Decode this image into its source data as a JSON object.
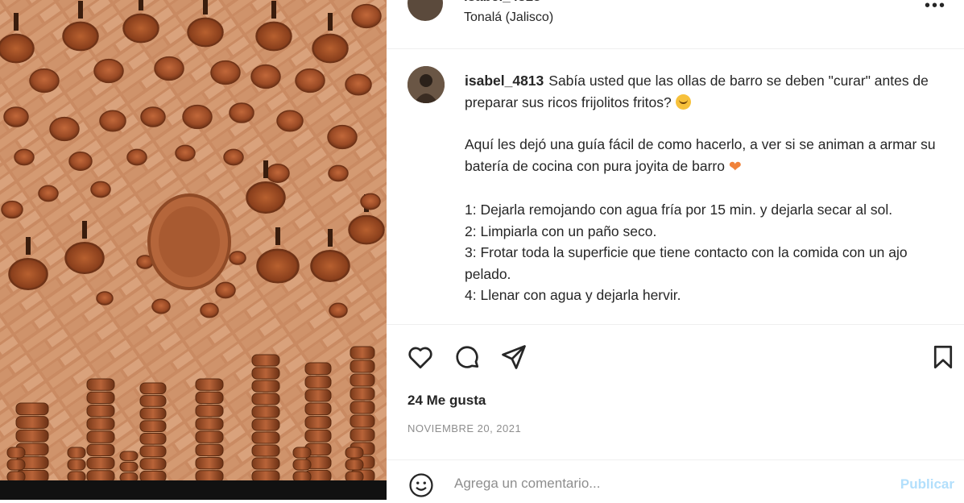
{
  "post": {
    "username": "isabel_4813",
    "location": "Tonalá (Jalisco)",
    "caption": {
      "line1": "Sabía usted que las ollas de barro se deben \"curar\" antes de preparar sus ricos frijolitos fritos?",
      "line2": "Aquí les dejó una guía fácil de como hacerlo, a ver si se animan a armar su batería de cocina con pura joyita de barro",
      "step1": "1: Dejarla remojando con agua fría por 15 min. y dejarla secar al sol.",
      "step2": "2: Limpiarla con un paño seco.",
      "step3": "3: Frotar toda la superficie que tiene contacto con la comida con un ajo pelado.",
      "step4": "4: Llenar con agua y dejarla hervir."
    },
    "likes": "24 Me gusta",
    "date": "NOVIEMBRE 20, 2021"
  },
  "icons": {
    "like": "heart-icon",
    "comment": "comment-icon",
    "share": "paper-plane-icon",
    "save": "bookmark-icon",
    "more": "more-options-icon",
    "emoji": "smiley-icon"
  },
  "comment_box": {
    "placeholder": "Agrega un comentario...",
    "post_label": "Publicar"
  },
  "colors": {
    "post_button": "#b2dffc",
    "secondary_text": "#8e8e8e"
  }
}
